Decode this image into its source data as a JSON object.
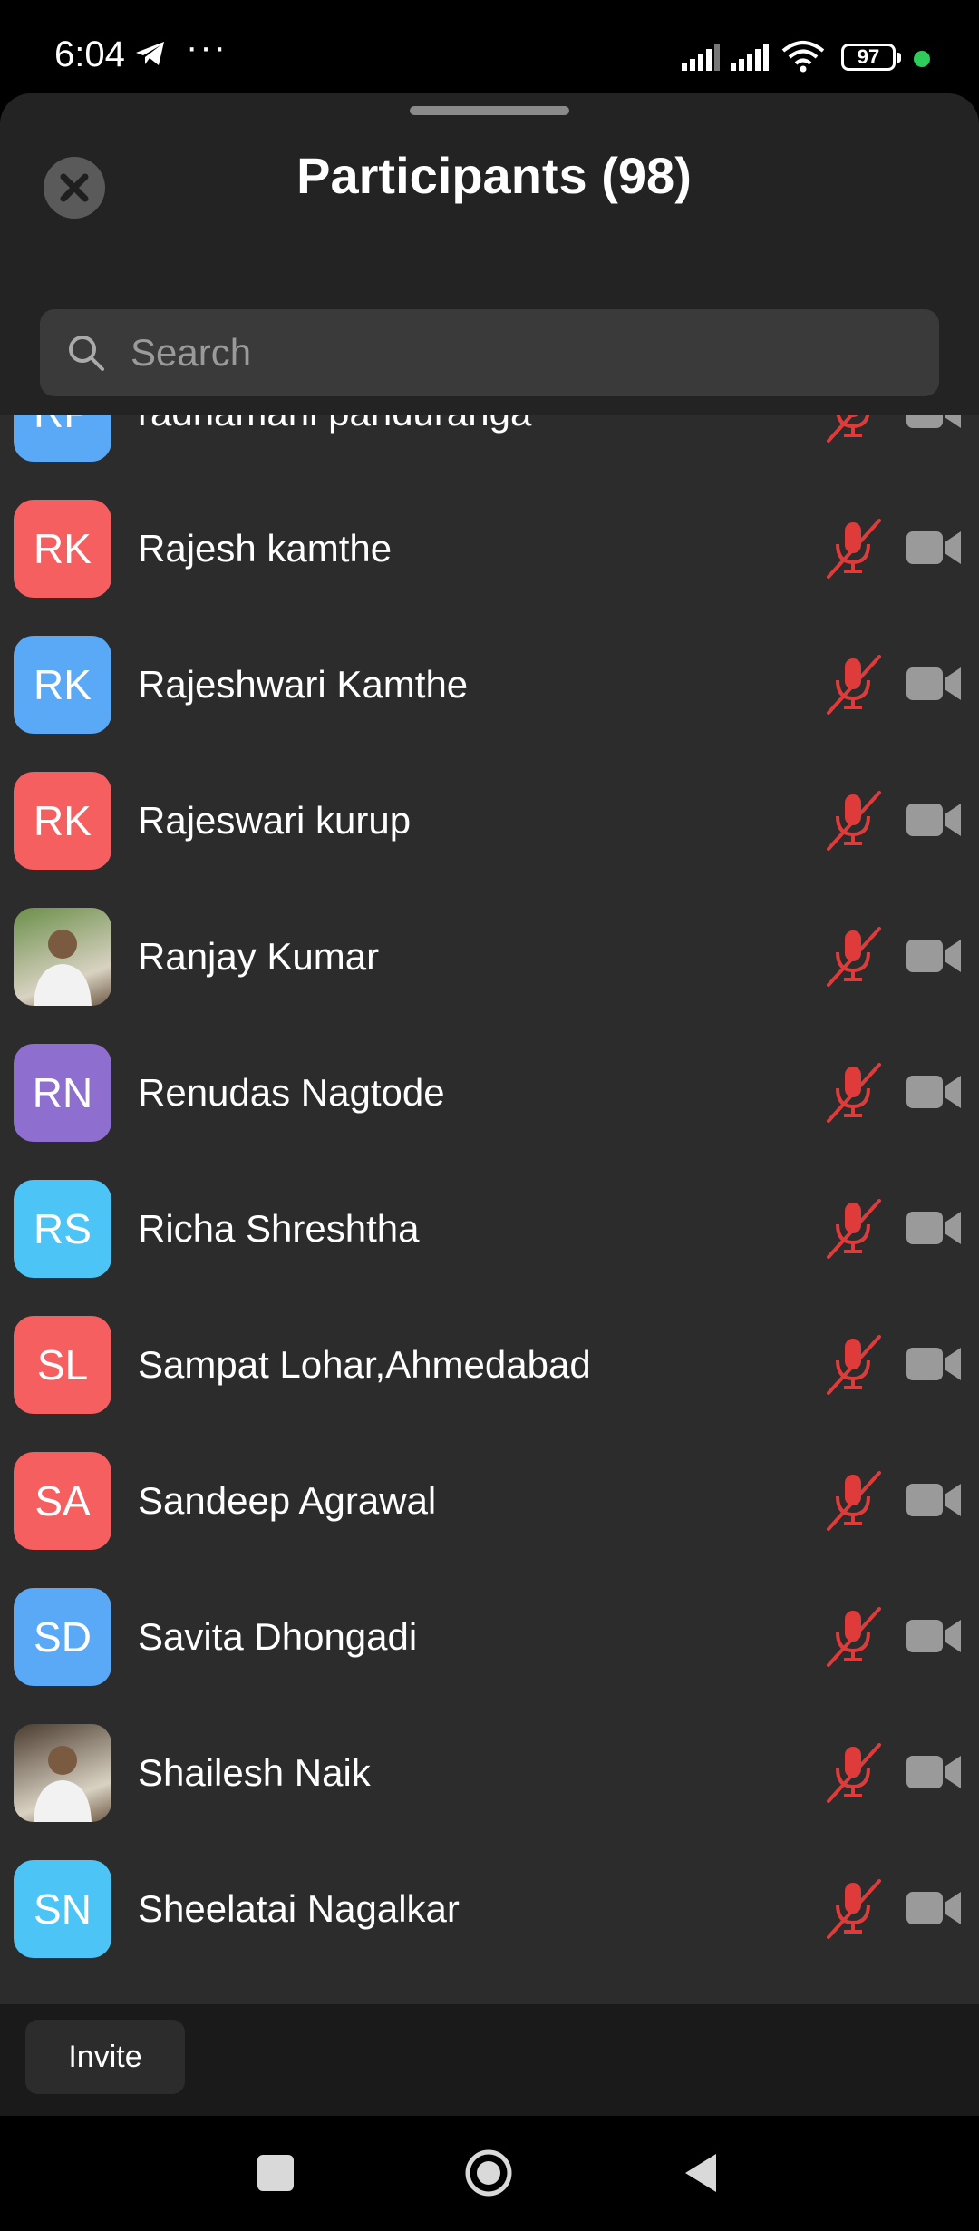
{
  "status_bar": {
    "time": "6:04",
    "battery": "97"
  },
  "sheet": {
    "title": "Participants (98)",
    "search_placeholder": "Search"
  },
  "participants": [
    {
      "initials": "RP",
      "name": "radhamani panduranga",
      "color": "#5aa9f7",
      "photo": false,
      "mic": "muted",
      "video": "off"
    },
    {
      "initials": "RK",
      "name": "Rajesh kamthe",
      "color": "#f55f5f",
      "photo": false,
      "mic": "muted",
      "video": "off"
    },
    {
      "initials": "RK",
      "name": "Rajeshwari Kamthe",
      "color": "#5aa9f7",
      "photo": false,
      "mic": "muted",
      "video": "off"
    },
    {
      "initials": "RK",
      "name": "Rajeswari kurup",
      "color": "#f55f5f",
      "photo": false,
      "mic": "muted",
      "video": "off"
    },
    {
      "initials": "",
      "name": "Ranjay Kumar",
      "color": "#6b8f4a",
      "photo": true,
      "mic": "muted",
      "video": "off"
    },
    {
      "initials": "RN",
      "name": "Renudas Nagtode",
      "color": "#8e6fcf",
      "photo": false,
      "mic": "muted",
      "video": "off"
    },
    {
      "initials": "RS",
      "name": "Richa Shreshtha",
      "color": "#4cc4f5",
      "photo": false,
      "mic": "muted",
      "video": "off"
    },
    {
      "initials": "SL",
      "name": "Sampat Lohar,Ahmedabad",
      "color": "#f55f5f",
      "photo": false,
      "mic": "muted",
      "video": "off"
    },
    {
      "initials": "SA",
      "name": "Sandeep Agrawal",
      "color": "#f55f5f",
      "photo": false,
      "mic": "muted",
      "video": "off"
    },
    {
      "initials": "SD",
      "name": "Savita Dhongadi",
      "color": "#5aa9f7",
      "photo": false,
      "mic": "muted",
      "video": "off"
    },
    {
      "initials": "",
      "name": "Shailesh Naik",
      "color": "#4a3b2f",
      "photo": true,
      "mic": "muted",
      "video": "off"
    },
    {
      "initials": "SN",
      "name": "Sheelatai Nagalkar",
      "color": "#4cc4f5",
      "photo": false,
      "mic": "muted",
      "video": "off"
    }
  ],
  "footer": {
    "invite_label": "Invite"
  },
  "colors": {
    "muted_red": "#e03b3b",
    "camera_grey": "#9a9a9a",
    "sheet_bg": "#232323",
    "list_bg": "#2c2c2c"
  }
}
